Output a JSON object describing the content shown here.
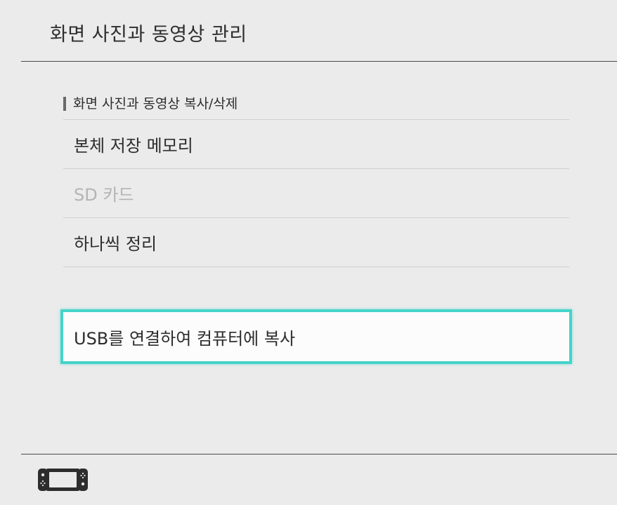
{
  "header": {
    "title": "화면 사진과 동영상 관리"
  },
  "section": {
    "label": "화면 사진과 동영상 복사/삭제"
  },
  "menu": {
    "items": [
      {
        "label": "본체 저장 메모리",
        "enabled": true
      },
      {
        "label": "SD 카드",
        "enabled": false
      },
      {
        "label": "하나씩 정리",
        "enabled": true
      }
    ]
  },
  "usb": {
    "label": "USB를 연결하여 컴퓨터에 복사",
    "selected": true
  },
  "footer": {
    "icon": "handheld-console-icon"
  },
  "colors": {
    "background": "#ebebeb",
    "text": "#2d2d2d",
    "disabled_text": "#b4b4b4",
    "selection_border": "#45d4c9",
    "divider": "#cfcfcf",
    "rule": "#4a4a4a"
  }
}
